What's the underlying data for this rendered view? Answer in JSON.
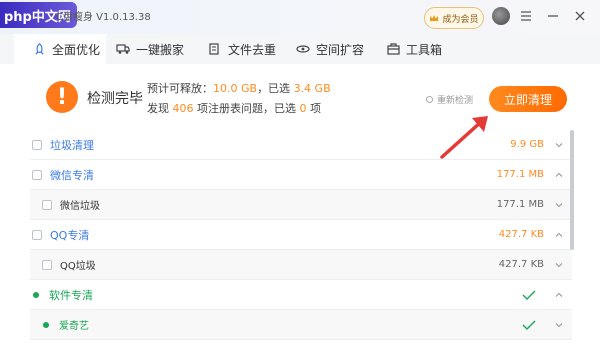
{
  "titlebar": {
    "logo_text": "php中文网",
    "app_title": "C盘瘦身 V1.0.13.38",
    "vip_label": "成为会员"
  },
  "tabs": [
    {
      "label": "全面优化",
      "icon": "rocket-icon",
      "active": true
    },
    {
      "label": "一键搬家",
      "icon": "truck-icon",
      "active": false
    },
    {
      "label": "文件去重",
      "icon": "files-icon",
      "active": false
    },
    {
      "label": "空间扩容",
      "icon": "expand-icon",
      "active": false
    },
    {
      "label": "工具箱",
      "icon": "toolbox-icon",
      "active": false
    }
  ],
  "summary": {
    "status": "检测完毕",
    "line1_prefix": "预计可释放：",
    "releasable": "10.0 GB",
    "line1_mid": "，已选",
    "selected": "3.4 GB",
    "line2_prefix": "发现",
    "found_count": "406",
    "line2_mid": "项注册表问题，已选",
    "selected_count": "0",
    "line2_suffix": "项",
    "rescan_label": "重新检测",
    "clean_label": "立即清理"
  },
  "list": [
    {
      "name": "垃圾清理",
      "size": "9.9 GB",
      "kind": "cat",
      "chevron": "down"
    },
    {
      "name": "微信专清",
      "size": "177.1 MB",
      "kind": "cat",
      "chevron": "up"
    },
    {
      "name": "微信垃圾",
      "size": "177.1 MB",
      "kind": "sub",
      "chevron": "down"
    },
    {
      "name": "QQ专清",
      "size": "427.7 KB",
      "kind": "cat",
      "chevron": "up"
    },
    {
      "name": "QQ垃圾",
      "size": "427.7 KB",
      "kind": "sub",
      "chevron": "down"
    },
    {
      "name": "软件专清",
      "size": "",
      "kind": "green",
      "chevron": "up"
    },
    {
      "name": "爱奇艺",
      "size": "",
      "kind": "green-sub",
      "chevron": "down"
    }
  ],
  "colors": {
    "accent": "#ff8a1f",
    "link": "#3c7be5",
    "ok": "#1aa855"
  }
}
